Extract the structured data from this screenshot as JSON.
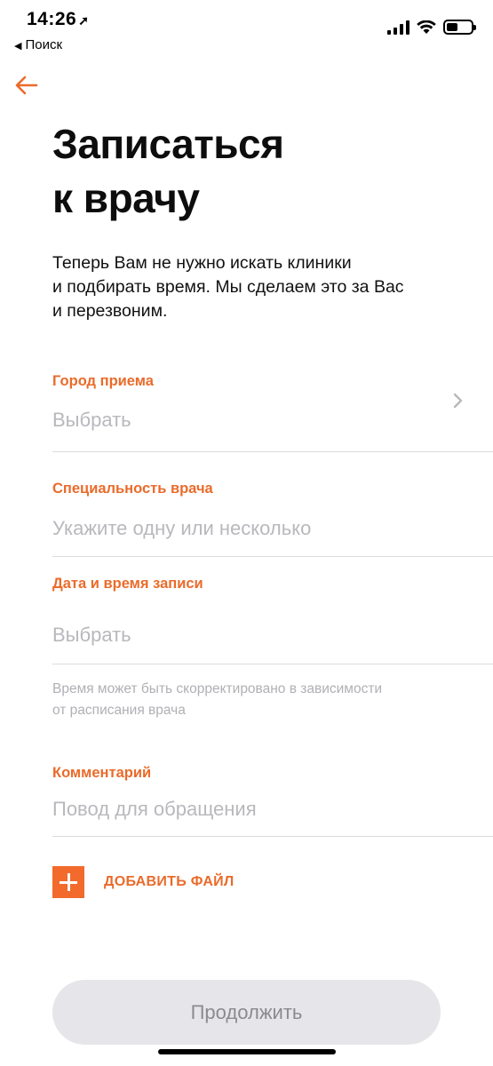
{
  "status_bar": {
    "time": "14:26",
    "location_glyph": "➚",
    "back_label": "Поиск",
    "back_glyph": "◀"
  },
  "header": {
    "back_icon": "arrow-left-icon",
    "title_line1": "Записаться",
    "title_line2": "к врачу"
  },
  "description": {
    "line1": "Теперь Вам не нужно искать клиники",
    "line2": "и подбирать время. Мы сделаем это за Вас",
    "line3": "и перезвоним."
  },
  "form": {
    "city": {
      "label": "Город приема",
      "placeholder": "Выбрать"
    },
    "specialty": {
      "label": "Специальность врача",
      "placeholder": "Укажите одну или несколько"
    },
    "datetime": {
      "label": "Дата и время записи",
      "placeholder": "Выбрать"
    },
    "hint_line1": "Время может быть скорректировано в зависимости",
    "hint_line2": "от расписания врача",
    "comment": {
      "label": "Комментарий",
      "placeholder": "Повод для обращения"
    },
    "add_file_label": "ДОБАВИТЬ ФАЙЛ",
    "continue_label": "Продолжить"
  },
  "colors": {
    "accent": "#ea6b2b",
    "placeholder": "#b8b8bd",
    "button_bg": "#e6e6ea",
    "button_text": "#8a8a90"
  }
}
